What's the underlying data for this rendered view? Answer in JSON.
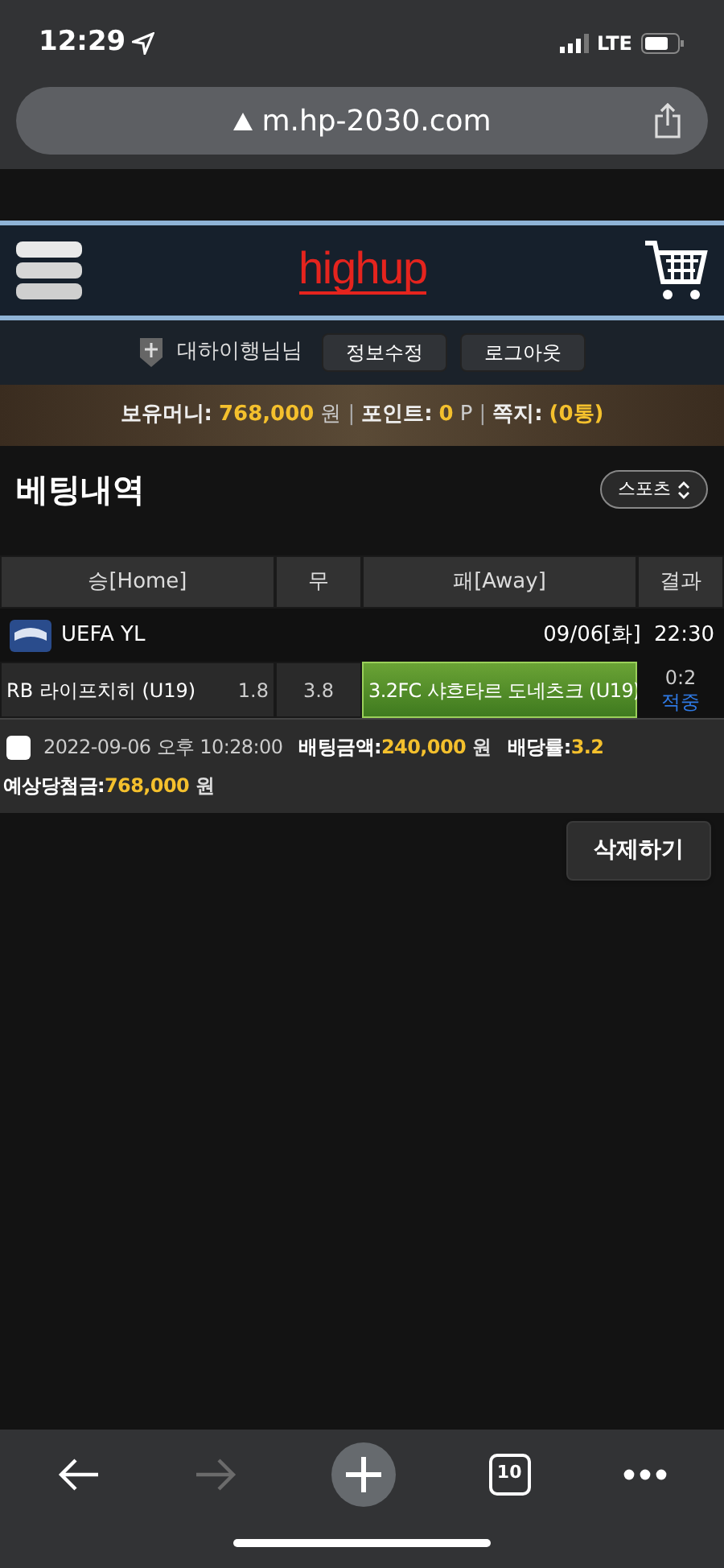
{
  "status_bar": {
    "time": "12:29",
    "network": "LTE"
  },
  "browser": {
    "url": "m.hp-2030.com",
    "tab_count": "10",
    "forward_disabled": true
  },
  "header": {
    "logo": "highup"
  },
  "user_bar": {
    "username": "대하이행님님",
    "buttons": [
      "정보수정",
      "로그아웃"
    ]
  },
  "money_bar_separator": "|",
  "money_bar": [
    {
      "label": "보유머니:",
      "value": "768,000",
      "unit": "원"
    },
    {
      "label": "포인트:",
      "value": "0",
      "unit": "P"
    },
    {
      "label": "쪽지:",
      "value": "(0통)"
    }
  ],
  "page": {
    "title": "베팅내역",
    "filter": "스포츠"
  },
  "table": {
    "columns": [
      "승[Home]",
      "무",
      "패[Away]",
      "결과"
    ],
    "league": {
      "name": "UEFA YL",
      "date": "09/06[화]",
      "time": "22:30"
    },
    "match": {
      "home": {
        "team": "RB 라이프치히 (U19)",
        "odds": "1.8",
        "selected": false
      },
      "draw": {
        "odds": "3.8",
        "selected": false
      },
      "away": {
        "team": "FC 샤흐타르 도네츠크 (U19)",
        "odds": "3.2",
        "selected": true
      },
      "score": "0:2",
      "result": "적중"
    },
    "bet": {
      "checked": false,
      "placed": "2022-09-06 오후 10:28:00",
      "fields": [
        {
          "label": "배팅금액:",
          "value": "240,000",
          "unit": "원"
        },
        {
          "label": "배당률:",
          "value": "3.2"
        },
        {
          "label": "예상당첨금:",
          "value": "768,000",
          "unit": "원"
        }
      ]
    }
  },
  "delete_button": "삭제하기"
}
